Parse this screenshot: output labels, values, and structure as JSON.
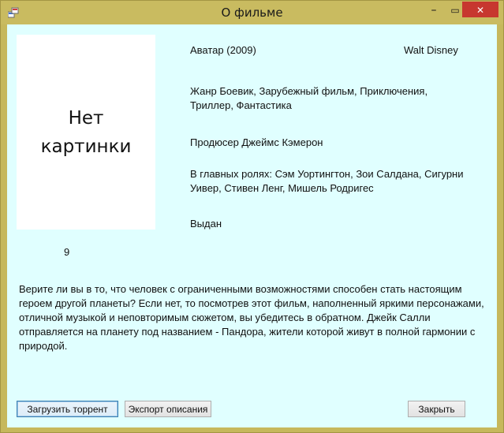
{
  "window": {
    "title": "О фильме",
    "controls": {
      "minimize": "–",
      "maximize": "▭",
      "close": "✕"
    },
    "close_color": "#c7372f",
    "background": "#e0ffff"
  },
  "poster": {
    "placeholder": "Нет\nкартинки",
    "rating": "9"
  },
  "film": {
    "title": "Аватар (2009)",
    "studio": "Walt Disney",
    "genre": "Жанр Боевик, Зарубежный фильм, Приключения, Триллер, Фантастика",
    "producer": "Продюсер Джеймс Кэмерон",
    "cast": "В главных ролях:  Сэм Уортингтон, Зои Салдана, Сигурни Уивер, Стивен Ленг, Мишель Родригес",
    "status": "Выдан",
    "description": "Верите ли вы в то, что человек с ограниченными возможностями способен стать настоящим героем другой планеты? Если нет, то посмотрев этот фильм, наполненный яркими персонажами, отличной музыкой и неповторимым сюжетом, вы убедитесь в обратном. Джейк Салли отправляется на планету под названием - Пандора, жители которой живут в полной гармонии с природой."
  },
  "buttons": {
    "download_torrent": "Загрузить торрент",
    "export_description": "Экспорт описания",
    "close": "Закрыть"
  }
}
